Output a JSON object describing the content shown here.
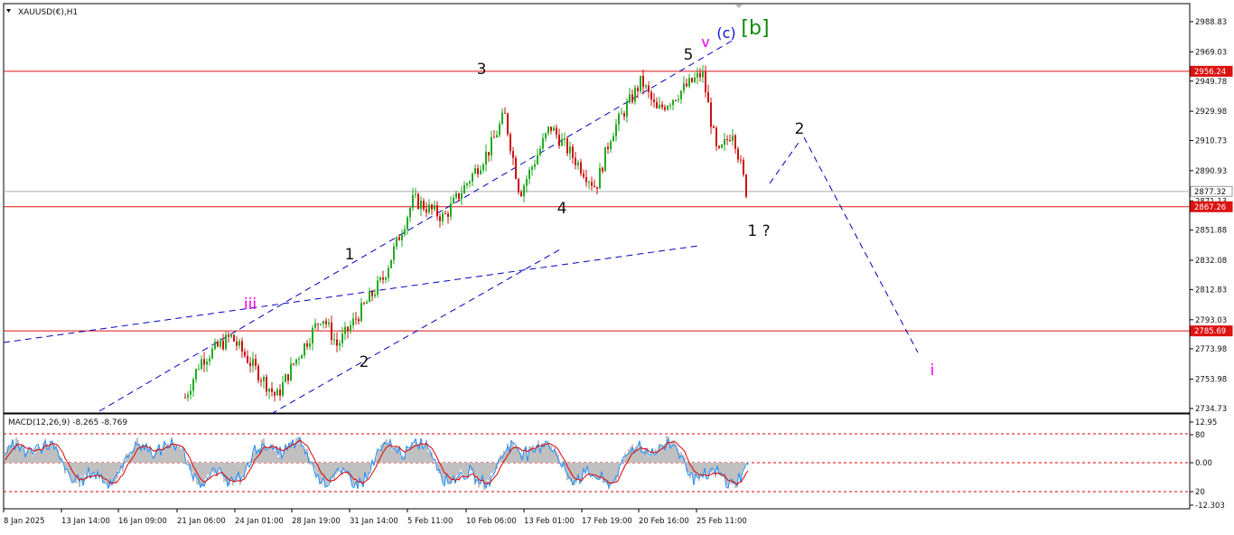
{
  "window": {
    "title": "XAUUSD(€),H1"
  },
  "colors": {
    "background": "#ffffff",
    "up_candle": "#22aa22",
    "down_candle": "#cc1111",
    "level_line": "#dd1111",
    "current_price_line": "#aaaaaa",
    "trend_line": "#0000bb",
    "macd_hist": "#c0c0c0",
    "macd_main": "#1e90ff",
    "macd_signal": "#dd0000",
    "label_black": "#111111",
    "label_magenta": "#ee00ee",
    "label_blue": "#1010dd",
    "label_green": "#0a8a0a"
  },
  "price_axis": {
    "ticks": [
      "2988.83",
      "2969.03",
      "2949.78",
      "2929.98",
      "2910.73",
      "2890.93",
      "2871.13",
      "2851.88",
      "2832.08",
      "2812.83",
      "2793.03",
      "2773.98",
      "2753.98",
      "2734.73"
    ],
    "markers": [
      {
        "value": "2956.24",
        "price": 2956.24,
        "kind": "level"
      },
      {
        "value": "2877.32",
        "price": 2877.32,
        "kind": "current"
      },
      {
        "value": "2867.26",
        "price": 2867.26,
        "kind": "level"
      },
      {
        "value": "2785.69",
        "price": 2785.69,
        "kind": "level"
      }
    ]
  },
  "macd": {
    "title": "MACD(12,26,9) -8.265 -8.769",
    "ticks": [
      "12.95",
      "80",
      "0.00",
      "20",
      "-12.303"
    ]
  },
  "time_axis": {
    "labels": [
      "8 Jan 2025",
      "13 Jan 14:00",
      "16 Jan 09:00",
      "21 Jan 06:00",
      "24 Jan 01:00",
      "28 Jan 19:00",
      "31 Jan 14:00",
      "5 Feb 11:00",
      "10 Feb 06:00",
      "13 Feb 01:00",
      "17 Feb 19:00",
      "20 Feb 16:00",
      "25 Feb 11:00"
    ]
  },
  "wave_labels": [
    {
      "text": "[b]",
      "color": "green"
    },
    {
      "text": "(c)",
      "color": "blue"
    },
    {
      "text": "v",
      "color": "magenta"
    },
    {
      "text": "5",
      "color": "black"
    },
    {
      "text": "3",
      "color": "black"
    },
    {
      "text": "4",
      "color": "black"
    },
    {
      "text": "1 ?",
      "color": "black"
    },
    {
      "text": "2",
      "color": "black"
    },
    {
      "text": "1",
      "color": "black"
    },
    {
      "text": "2",
      "color": "black"
    },
    {
      "text": "iii",
      "color": "magenta"
    },
    {
      "text": "i",
      "color": "magenta"
    }
  ],
  "chart_data": {
    "type": "candlestick",
    "symbol": "XAUUSD(€)",
    "timeframe": "H1",
    "ylim": [
      2734.73,
      2988.83
    ],
    "waypoints": [
      {
        "date": "2025-01-21",
        "close": 2742
      },
      {
        "date": "2025-01-22",
        "close": 2766
      },
      {
        "date": "2025-01-24",
        "close": 2782
      },
      {
        "date": "2025-01-27",
        "close": 2742
      },
      {
        "date": "2025-01-28",
        "close": 2762
      },
      {
        "date": "2025-01-30",
        "close": 2796
      },
      {
        "date": "2025-01-31",
        "close": 2776
      },
      {
        "date": "2025-02-03",
        "close": 2820
      },
      {
        "date": "2025-02-05",
        "close": 2872
      },
      {
        "date": "2025-02-07",
        "close": 2860
      },
      {
        "date": "2025-02-10",
        "close": 2905
      },
      {
        "date": "2025-02-11",
        "close": 2928
      },
      {
        "date": "2025-02-12",
        "close": 2876
      },
      {
        "date": "2025-02-14",
        "close": 2920
      },
      {
        "date": "2025-02-17",
        "close": 2880
      },
      {
        "date": "2025-02-18",
        "close": 2915
      },
      {
        "date": "2025-02-20",
        "close": 2950
      },
      {
        "date": "2025-02-21",
        "close": 2930
      },
      {
        "date": "2025-02-24",
        "close": 2955
      },
      {
        "date": "2025-02-25",
        "close": 2900
      },
      {
        "date": "2025-02-26",
        "close": 2918
      },
      {
        "date": "2025-02-27",
        "close": 2872
      }
    ],
    "horizontal_levels": [
      2956.24,
      2867.26,
      2785.69
    ],
    "current_price": 2877.32,
    "projection": [
      {
        "label": "2",
        "price": 2910
      },
      {
        "label": "i",
        "price": 2775
      }
    ]
  }
}
